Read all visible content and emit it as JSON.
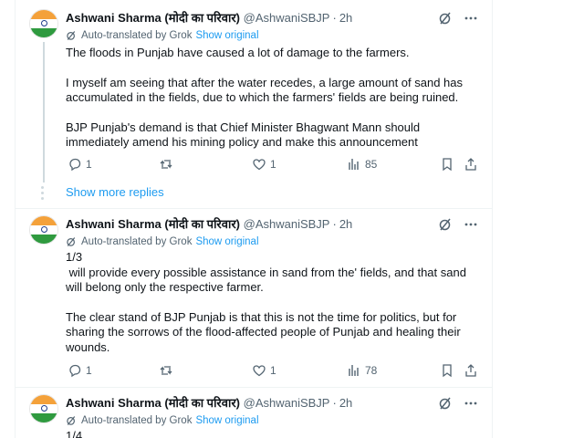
{
  "tweets": [
    {
      "name": "Ashwani Sharma (मोदी का परिवार)",
      "handle": "@AshwaniSBJP",
      "time": "2h",
      "grok_label": "Auto-translated by Grok",
      "show_original": "Show original",
      "paragraphs": [
        "The floods in Punjab have caused a lot of damage to the farmers.",
        "I myself am seeing that after the water recedes, a large amount of sand has accumulated in the fields, due to which the farmers' fields are being ruined.",
        "BJP Punjab's demand is that Chief Minister Bhagwant Mann should immediately amend his mining policy and make this announcement"
      ],
      "replies": "1",
      "retweets": "",
      "likes": "1",
      "views": "85"
    },
    {
      "name": "Ashwani Sharma (मोदी का परिवार)",
      "handle": "@AshwaniSBJP",
      "time": "2h",
      "grok_label": "Auto-translated by Grok",
      "show_original": "Show original",
      "paragraphs": [
        "1/3\n will provide every possible assistance in sand from the' fields, and that sand will belong only the respective farmer.",
        "The clear stand of BJP Punjab is that this is not the time for politics, but for sharing the sorrows of the flood-affected people of Punjab and healing their wounds."
      ],
      "replies": "1",
      "retweets": "",
      "likes": "1",
      "views": "78"
    },
    {
      "name": "Ashwani Sharma (मोदी का परिवार)",
      "handle": "@AshwaniSBJP",
      "time": "2h",
      "grok_label": "Auto-translated by Grok",
      "show_original": "Show original",
      "paragraphs": [
        "1/4"
      ]
    }
  ],
  "show_more_replies": "Show more replies",
  "colors": {
    "accent": "#1d9bf0",
    "muted": "#536471",
    "text": "#0f1419",
    "border": "#eff3f4"
  },
  "icons": [
    "grok-icon",
    "more-icon",
    "reply-icon",
    "retweet-icon",
    "like-icon",
    "views-icon",
    "bookmark-icon",
    "share-icon"
  ]
}
